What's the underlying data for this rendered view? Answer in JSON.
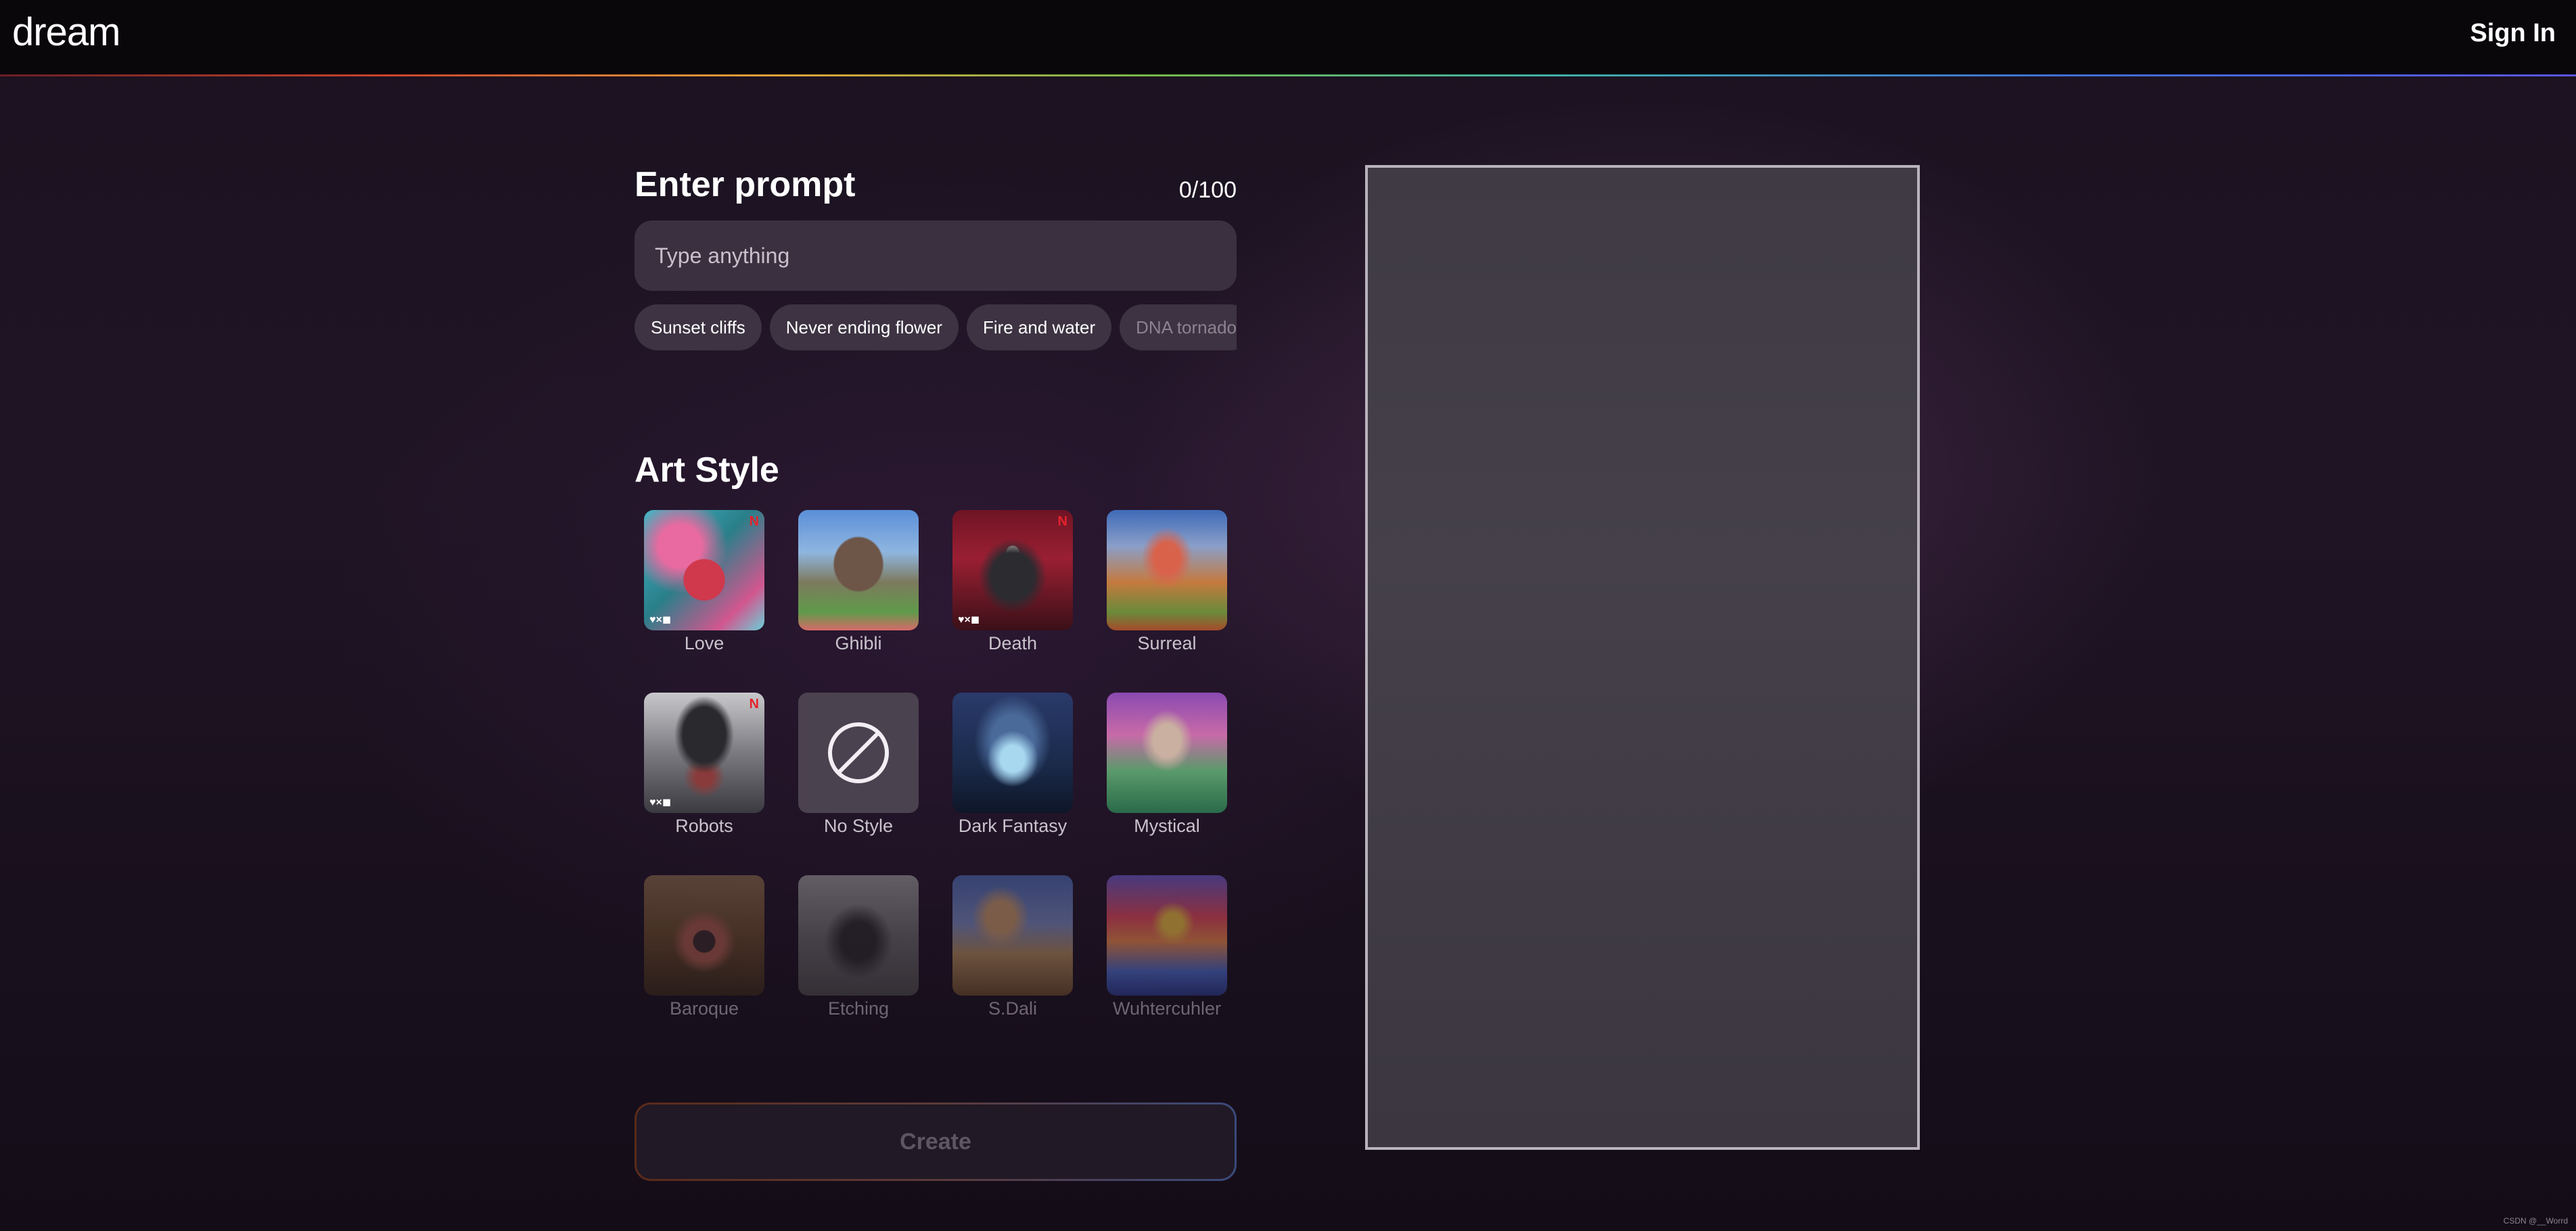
{
  "header": {
    "logo": "dream",
    "sign_in": "Sign In"
  },
  "prompt": {
    "title": "Enter prompt",
    "counter": "0/100",
    "placeholder": "Type anything",
    "suggestions": [
      "Sunset cliffs",
      "Never ending flower",
      "Fire and water",
      "DNA tornado"
    ]
  },
  "art_style": {
    "title": "Art Style",
    "styles": [
      {
        "label": "Love"
      },
      {
        "label": "Ghibli"
      },
      {
        "label": "Death"
      },
      {
        "label": "Surreal"
      },
      {
        "label": "Robots"
      },
      {
        "label": "No Style"
      },
      {
        "label": "Dark Fantasy"
      },
      {
        "label": "Mystical"
      },
      {
        "label": "Baroque"
      },
      {
        "label": "Etching"
      },
      {
        "label": "S.Dali"
      },
      {
        "label": "Wuhtercuhler"
      }
    ],
    "badges": {
      "netflix": "N",
      "collab": "♥×◼"
    }
  },
  "create_label": "Create",
  "watermark": "CSDN @__Worrd"
}
